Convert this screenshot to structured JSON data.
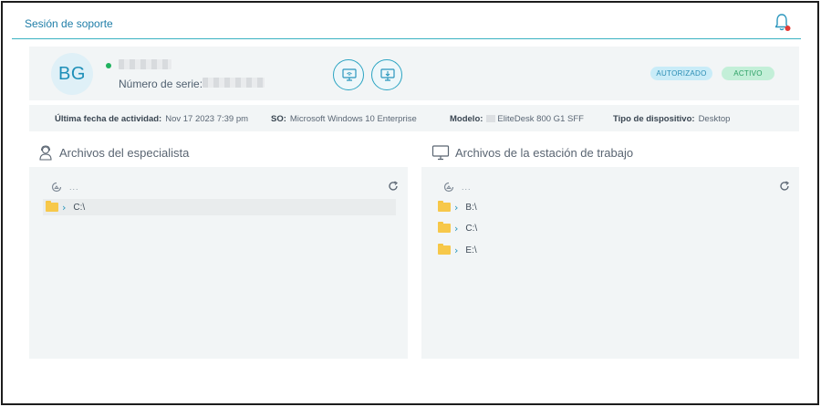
{
  "header": {
    "title": "Sesión de soporte"
  },
  "device": {
    "avatar_initials": "BG",
    "status": "online",
    "serial_label": "Número de serie:",
    "badges": {
      "authorized": "AUTORIZADO",
      "active": "ACTIVO"
    }
  },
  "info": {
    "last_activity_label": "Última fecha de actividad:",
    "last_activity_value": "Nov 17 2023 7:39 pm",
    "os_label": "SO:",
    "os_value": "Microsoft Windows 10 Enterprise",
    "model_label": "Modelo:",
    "model_value": "EliteDesk 800 G1 SFF",
    "device_type_label": "Tipo de dispositivo:",
    "device_type_value": "Desktop"
  },
  "specialist_files": {
    "title": "Archivos del especialista",
    "path": "...",
    "items": [
      {
        "label": "C:\\"
      }
    ]
  },
  "workstation_files": {
    "title": "Archivos de la estación de trabajo",
    "path": "...",
    "items": [
      {
        "label": "B:\\"
      },
      {
        "label": "C:\\"
      },
      {
        "label": "E:\\"
      }
    ]
  },
  "colors": {
    "accent": "#1f7ea8",
    "online": "#21b25f",
    "folder": "#f7c84a",
    "notification": "#e53935"
  },
  "icons": {
    "bell": "bell-icon",
    "remote_desktop": "remote-desktop-icon",
    "file_transfer": "file-transfer-icon",
    "specialist": "user-headset-icon",
    "workstation": "monitor-icon",
    "refresh": "refresh-icon",
    "home": "home-path-icon",
    "folder": "folder-icon",
    "chevron": "chevron-right-icon"
  }
}
